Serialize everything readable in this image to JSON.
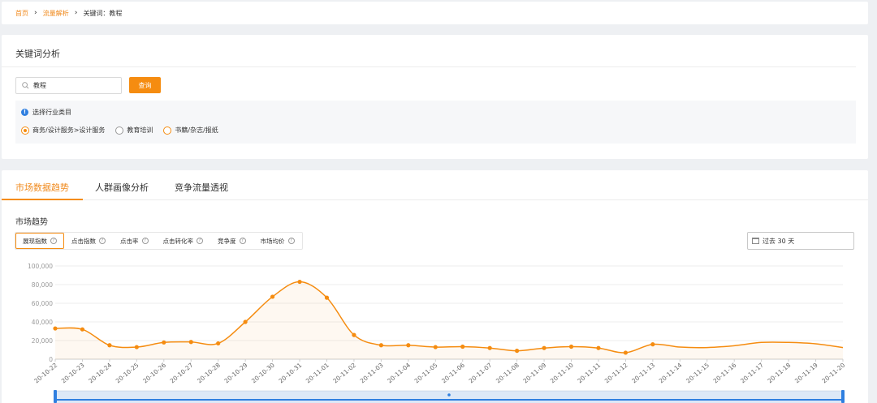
{
  "breadcrumb": {
    "home": "首页",
    "traffic": "流量解析",
    "current": "关键词：教程"
  },
  "keyword_analysis": {
    "title": "关键词分析",
    "search_value": "教程",
    "query_label": "查询",
    "industry_title": "选择行业类目",
    "industries": [
      "商务/设计服务>设计服务",
      "教育培训",
      "书籍/杂志/报纸"
    ]
  },
  "tabs": [
    "市场数据趋势",
    "人群画像分析",
    "竞争流量透视"
  ],
  "trend": {
    "title": "市场趋势",
    "metrics": [
      "展现指数",
      "点击指数",
      "点击率",
      "点击转化率",
      "竞争度",
      "市场均价"
    ],
    "range": "过去 30 天"
  },
  "colors": {
    "accent": "#f58c10",
    "info": "#2f7fe0",
    "slider": "#2f7fe0"
  },
  "chart_data": {
    "type": "line",
    "title": "",
    "xlabel": "",
    "ylabel": "",
    "ylim": [
      0,
      100000
    ],
    "yticks": [
      0,
      20000,
      40000,
      60000,
      80000,
      100000
    ],
    "ytick_labels": [
      "0",
      "20,000",
      "40,000",
      "60,000",
      "80,000",
      "100,000"
    ],
    "grid": true,
    "x": [
      "20-10-22",
      "20-10-23",
      "20-10-24",
      "20-10-25",
      "20-10-26",
      "20-10-27",
      "20-10-28",
      "20-10-29",
      "20-10-30",
      "20-10-31",
      "20-11-01",
      "20-11-02",
      "20-11-03",
      "20-11-04",
      "20-11-05",
      "20-11-06",
      "20-11-07",
      "20-11-08",
      "20-11-09",
      "20-11-10",
      "20-11-11",
      "20-11-12",
      "20-11-13",
      "20-11-14",
      "20-11-15",
      "20-11-16",
      "20-11-17",
      "20-11-18",
      "20-11-19",
      "20-11-20"
    ],
    "series": [
      {
        "values": [
          33000,
          32000,
          15000,
          13000,
          18000,
          18500,
          17000,
          40000,
          67000,
          83000,
          66000,
          26000,
          15000,
          15000,
          13000,
          13500,
          12000,
          9000,
          12000,
          13500,
          12000,
          7000,
          16000,
          13000,
          12500,
          14500,
          18000,
          18000,
          16500,
          12500
        ],
        "markers": [
          true,
          true,
          true,
          true,
          true,
          true,
          true,
          true,
          true,
          true,
          true,
          true,
          true,
          true,
          true,
          true,
          true,
          true,
          true,
          true,
          true,
          true,
          true,
          false,
          false,
          false,
          false,
          false,
          false,
          false
        ]
      }
    ]
  }
}
